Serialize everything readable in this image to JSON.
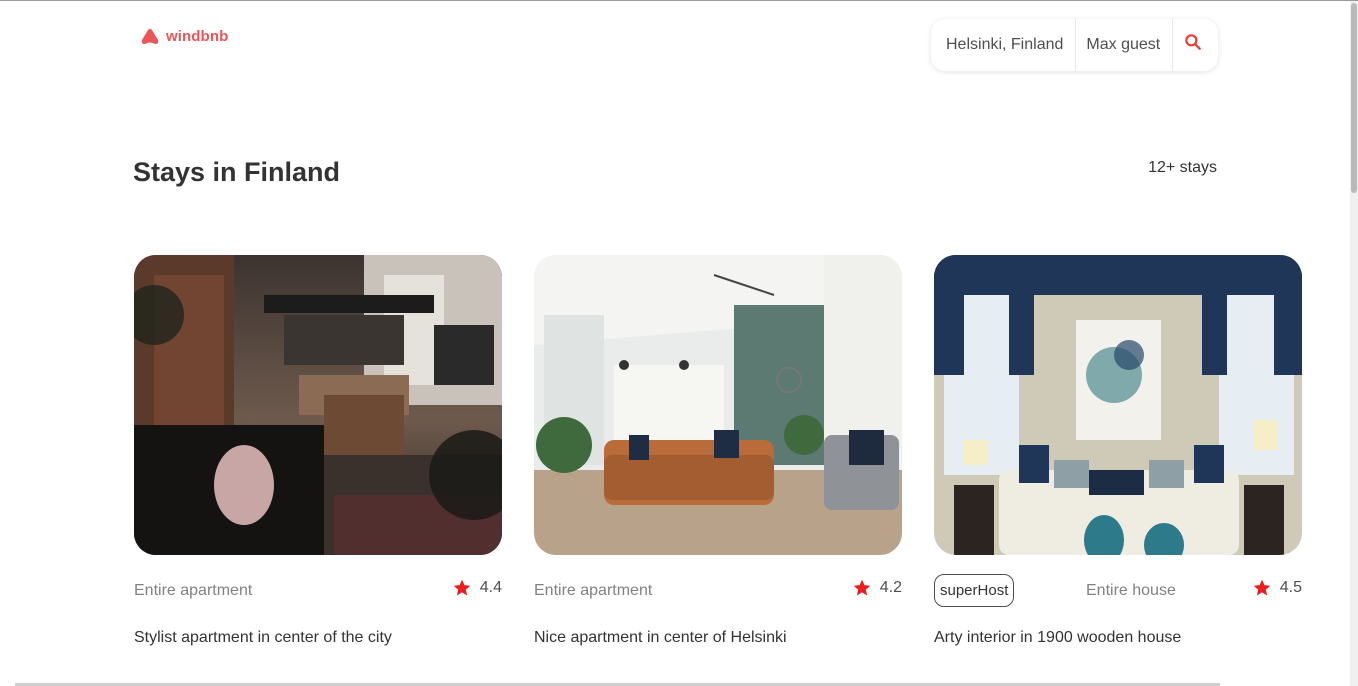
{
  "header": {
    "logo_text": "windbnb",
    "brand_color": "#eb5757",
    "search": {
      "location": "Helsinki, Finland",
      "guests": "Max guest",
      "icon": "search-icon"
    }
  },
  "main": {
    "title": "Stays in Finland",
    "count": "12+ stays"
  },
  "stays": [
    {
      "type": "Entire apartment",
      "rating": "4.4",
      "title": "Stylist apartment in center of the city",
      "superhost": false
    },
    {
      "type": "Entire apartment",
      "rating": "4.2",
      "title": "Nice apartment in center of Helsinki",
      "superhost": false
    },
    {
      "type": "Entire house",
      "rating": "4.5",
      "title": "Arty interior in 1900 wooden house",
      "superhost": true,
      "superhost_label": "superHost"
    }
  ],
  "colors": {
    "accent": "#eb5757",
    "star": "#eb1d1d",
    "text_dark": "#333333",
    "text_muted": "#828282"
  }
}
